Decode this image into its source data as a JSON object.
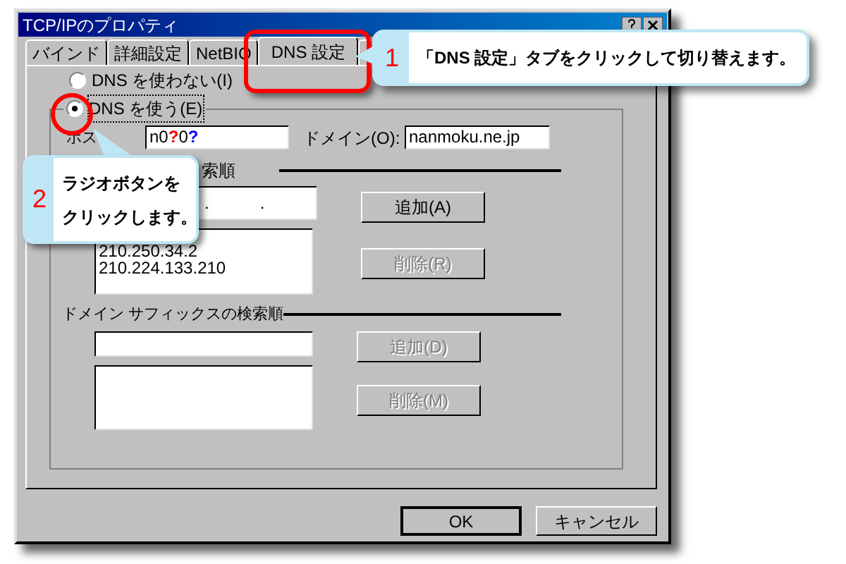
{
  "window": {
    "title": "TCP/IPのプロパティ"
  },
  "tabs": [
    {
      "label": "バインド",
      "selected": false
    },
    {
      "label": "詳細設定",
      "selected": false
    },
    {
      "label": "NetBIO",
      "selected": false
    },
    {
      "label": "DNS 設定",
      "selected": true
    }
  ],
  "dns_mode": [
    {
      "label": "DNS を使わない(I)",
      "selected": false
    },
    {
      "label": "DNS を使う(E)",
      "selected": true
    }
  ],
  "host": {
    "label": "ホス",
    "value": [
      {
        "text": "n0",
        "color": "#000000"
      },
      {
        "text": "?",
        "color": "#ff0000"
      },
      {
        "text": "0",
        "color": "#000000"
      },
      {
        "text": "?",
        "color": "#0000ff"
      }
    ]
  },
  "domain": {
    "label": "ドメイン(O):",
    "value": "nanmoku.ne.jp"
  },
  "dns_server_search": {
    "heading": "索順",
    "address_separators": [
      ".",
      "."
    ],
    "buttons": [
      {
        "label": "追加(A)",
        "disabled": false
      },
      {
        "label": "削除(R)",
        "disabled": true
      }
    ],
    "list": [
      "210.250.34.2",
      "210.224.133.210"
    ]
  },
  "suffix_search": {
    "heading": "ドメイン サフィックスの検索順",
    "buttons": [
      {
        "label": "追加(D)",
        "disabled": true
      },
      {
        "label": "削除(M)",
        "disabled": true
      }
    ]
  },
  "dialog_buttons": [
    {
      "label": "OK",
      "default": true
    },
    {
      "label": "キャンセル",
      "default": false
    }
  ],
  "callouts": [
    {
      "number": "1",
      "lines": [
        "「DNS 設定」タブをクリックして切り替えます。"
      ]
    },
    {
      "number": "2",
      "lines": [
        "ラジオボタンを",
        "クリックします。"
      ]
    }
  ]
}
